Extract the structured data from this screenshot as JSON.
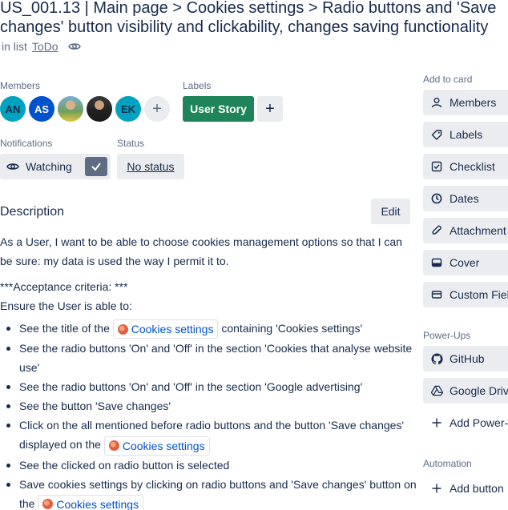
{
  "card": {
    "title_line1": "US_001.13 | Main page > Cookies settings > Radio buttons and 'Save",
    "title_line2": "changes' button visibility and clickability, changes saving functionality",
    "in_list_prefix": "in list",
    "list_name": "ToDo"
  },
  "members": {
    "label": "Members",
    "avatars": [
      {
        "initials": "AN"
      },
      {
        "initials": "AS"
      },
      {
        "initials": ""
      },
      {
        "initials": ""
      },
      {
        "initials": "EK"
      }
    ],
    "add": "+"
  },
  "labels": {
    "label": "Labels",
    "items": [
      {
        "name": "User Story",
        "color": "#1f845a"
      }
    ],
    "add": "+"
  },
  "notifications": {
    "label": "Notifications",
    "button": "Watching"
  },
  "status": {
    "label": "Status",
    "value": "No status"
  },
  "description": {
    "title": "Description",
    "edit": "Edit",
    "intro": "As a User, I want to be able to choose cookies management options so that I can be sure: my data is used the way I permit it to.",
    "criteria_line1": "***Acceptance criteria: ***",
    "criteria_line2": "Ensure the User is able to:",
    "link_text": "Cookies settings",
    "items": [
      {
        "before": "See the title of the",
        "after": "containing 'Cookies settings'"
      },
      {
        "text": "See the radio buttons 'On' and 'Off' in the section 'Cookies that analyse website use'"
      },
      {
        "text": "See the radio buttons 'On' and 'Off' in the section 'Google advertising'"
      },
      {
        "text": "See the button 'Save changes'"
      },
      {
        "text": "Click on the all mentioned before radio buttons and the button 'Save changes' displayed on the"
      },
      {
        "text": "See the clicked on radio button is selected"
      },
      {
        "text": "Save cookies settings by clicking on radio buttons and 'Save changes' button on the"
      }
    ]
  },
  "sidebar": {
    "add_to_card_label": "Add to card",
    "add_to_card": [
      {
        "label": "Members",
        "icon": "person-icon"
      },
      {
        "label": "Labels",
        "icon": "tag-icon"
      },
      {
        "label": "Checklist",
        "icon": "checklist-icon"
      },
      {
        "label": "Dates",
        "icon": "clock-icon"
      },
      {
        "label": "Attachment",
        "icon": "paperclip-icon"
      },
      {
        "label": "Cover",
        "icon": "cover-icon"
      },
      {
        "label": "Custom Fields",
        "icon": "custom-fields-icon"
      }
    ],
    "power_ups_label": "Power-Ups",
    "power_ups": [
      {
        "label": "GitHub",
        "icon": "github-icon"
      },
      {
        "label": "Google Drive",
        "icon": "google-drive-icon"
      },
      {
        "label": "Add Power-Ups",
        "icon": "plus-icon"
      }
    ],
    "automation_label": "Automation",
    "automation": [
      {
        "label": "Add button",
        "icon": "plus-icon"
      }
    ]
  }
}
